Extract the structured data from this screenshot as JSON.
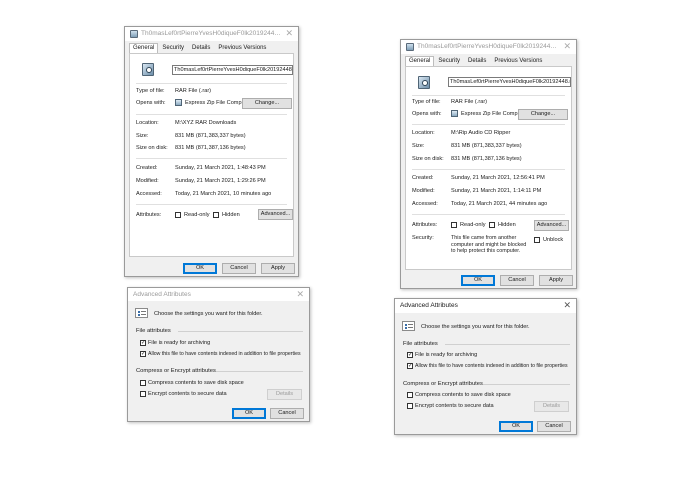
{
  "left_properties": {
    "title": "Th0masLef0rtPierreYvesH0diqueF0lk20192448.rar Prop...",
    "tabs": [
      "General",
      "Security",
      "Details",
      "Previous Versions"
    ],
    "filename": "Th0masLef0rtPierreYvesH0diqueF0lk20192448.rar",
    "type_label": "Type of file:",
    "type_value": "RAR File (.rar)",
    "opens_label": "Opens with:",
    "opens_value": "Express Zip File Compr",
    "change_button": "Change...",
    "location_label": "Location:",
    "location_value": "M:\\XYZ RAR Downloads",
    "size_label": "Size:",
    "size_value": "831 MB (871,383,337 bytes)",
    "size_on_disk_label": "Size on disk:",
    "size_on_disk_value": "831 MB (871,387,136 bytes)",
    "created_label": "Created:",
    "created_value": "Sunday, 21 March 2021, 1:48:43 PM",
    "modified_label": "Modified:",
    "modified_value": "Sunday, 21 March 2021, 1:29:26 PM",
    "accessed_label": "Accessed:",
    "accessed_value": "Today, 21 March 2021, 10 minutes ago",
    "attributes_label": "Attributes:",
    "readonly_label": "Read-only",
    "hidden_label": "Hidden",
    "advanced_button": "Advanced...",
    "ok_button": "OK",
    "cancel_button": "Cancel",
    "apply_button": "Apply"
  },
  "right_properties": {
    "title": "Th0masLef0rtPierreYvesH0diqueF0lk20192448.rar Prop...",
    "tabs": [
      "General",
      "Security",
      "Details",
      "Previous Versions"
    ],
    "filename": "Th0masLef0rtPierreYvesH0diqueF0lk20192448.rar",
    "type_label": "Type of file:",
    "type_value": "RAR File (.rar)",
    "opens_label": "Opens with:",
    "opens_value": "Express Zip File Compr",
    "change_button": "Change...",
    "location_label": "Location:",
    "location_value": "M:\\Rip Audio CD Ripper",
    "size_label": "Size:",
    "size_value": "831 MB (871,383,337 bytes)",
    "size_on_disk_label": "Size on disk:",
    "size_on_disk_value": "831 MB (871,387,136 bytes)",
    "created_label": "Created:",
    "created_value": "Sunday, 21 March 2021, 12:56:41 PM",
    "modified_label": "Modified:",
    "modified_value": "Sunday, 21 March 2021, 1:14:11 PM",
    "accessed_label": "Accessed:",
    "accessed_value": "Today, 21 March 2021, 44 minutes ago",
    "attributes_label": "Attributes:",
    "readonly_label": "Read-only",
    "hidden_label": "Hidden",
    "advanced_button": "Advanced...",
    "security_label": "Security:",
    "security_text": "This file came from another computer and might be blocked to help protect this computer.",
    "unblock_label": "Unblock",
    "ok_button": "OK",
    "cancel_button": "Cancel",
    "apply_button": "Apply"
  },
  "left_advanced": {
    "title": "Advanced Attributes",
    "intro": "Choose the settings you want for this folder.",
    "file_attributes_title": "File attributes",
    "archive_label": "File is ready for archiving",
    "archive_checked": true,
    "index_label": "Allow this file to have contents indexed in addition to file properties",
    "index_checked": true,
    "compress_title": "Compress or Encrypt attributes",
    "compress_label": "Compress contents to save disk space",
    "encrypt_label": "Encrypt contents to secure data",
    "details_button": "Details",
    "ok_button": "OK",
    "cancel_button": "Cancel"
  },
  "right_advanced": {
    "title": "Advanced Attributes",
    "intro": "Choose the settings you want for this folder.",
    "file_attributes_title": "File attributes",
    "archive_label": "File is ready for archiving",
    "archive_checked": true,
    "index_label": "Allow this file to have contents indexed in addition to file properties",
    "index_checked": true,
    "compress_title": "Compress or Encrypt attributes",
    "compress_label": "Compress contents to save disk space",
    "encrypt_label": "Encrypt contents to secure data",
    "details_button": "Details",
    "ok_button": "OK",
    "cancel_button": "Cancel"
  },
  "icons": {
    "close": "close-icon",
    "file": "rar-file-icon",
    "app": "express-zip-icon",
    "info": "attributes-info-icon"
  }
}
